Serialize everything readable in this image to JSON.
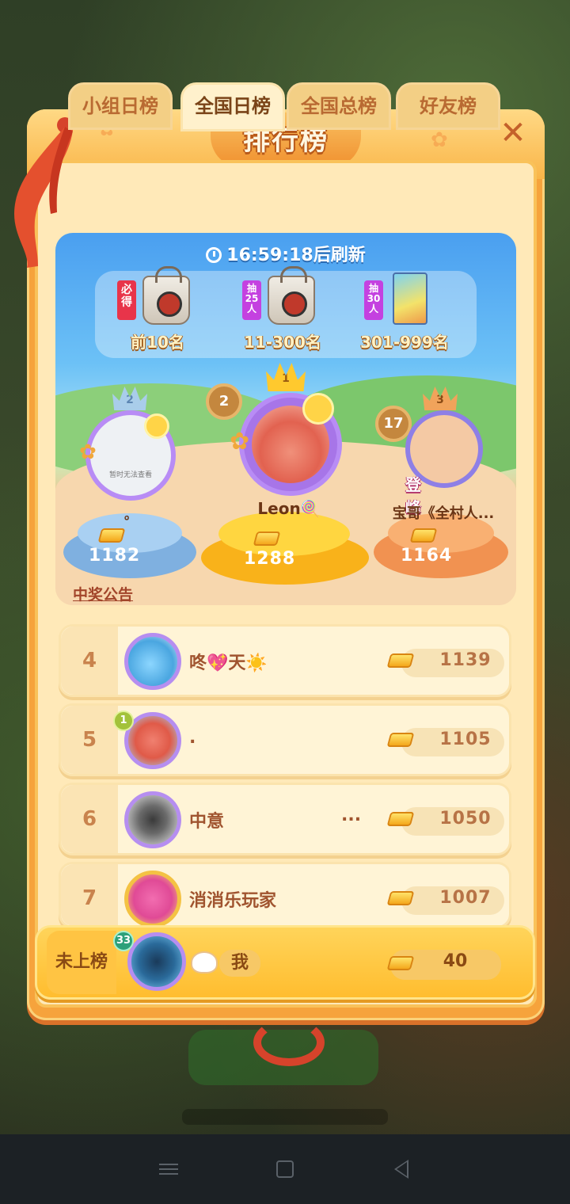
{
  "header": {
    "title": "排行榜",
    "close_icon": "close-icon"
  },
  "tabs": [
    {
      "label": "小组日榜",
      "active": false
    },
    {
      "label": "全国日榜",
      "active": true
    },
    {
      "label": "全国总榜",
      "active": false
    },
    {
      "label": "好友榜",
      "active": false
    }
  ],
  "refresh": {
    "text": "16:59:18后刷新",
    "icon": "clock-icon"
  },
  "prizes": [
    {
      "tag": "必得",
      "label": "前10名",
      "icon": "gift-bag-icon",
      "tag_color": "#e8344a"
    },
    {
      "tag": "抽25人",
      "label": "11-300名",
      "icon": "gift-bag-icon",
      "tag_color": "#c441e0"
    },
    {
      "tag": "抽30人",
      "label": "301-999名",
      "icon": "book-icon",
      "tag_color": "#c441e0"
    }
  ],
  "podium": {
    "first": {
      "rank": "1",
      "level": "2",
      "name": "Leon🍭",
      "score": "1288"
    },
    "second": {
      "rank": "2",
      "avatar_text": "暂时无法查看",
      "name": "。",
      "score": "1182"
    },
    "third": {
      "rank": "3",
      "level": "17",
      "badge": "登峰造极",
      "name": "宝哥《全村人...",
      "score": "1164"
    }
  },
  "notice_link": "中奖公告",
  "ranking": [
    {
      "rank": "4",
      "name": "咚💖天☀️",
      "extra": "",
      "score": "1139"
    },
    {
      "rank": "5",
      "name": ".",
      "extra": "",
      "score": "1105",
      "level": "1"
    },
    {
      "rank": "6",
      "name": "中意",
      "extra": "...",
      "score": "1050"
    },
    {
      "rank": "7",
      "name": "消消乐玩家",
      "extra": "",
      "score": "1007"
    }
  ],
  "me": {
    "rank_label": "未上榜",
    "level": "33",
    "name": "我",
    "score": "40"
  },
  "colors": {
    "panel": "#f6a33c",
    "inner": "#ffe9b8",
    "sky": "#4a9ff0",
    "gold_pedestal": "#ffc52e",
    "blue_pedestal": "#8bbde9",
    "orange_pedestal": "#f6a356"
  }
}
